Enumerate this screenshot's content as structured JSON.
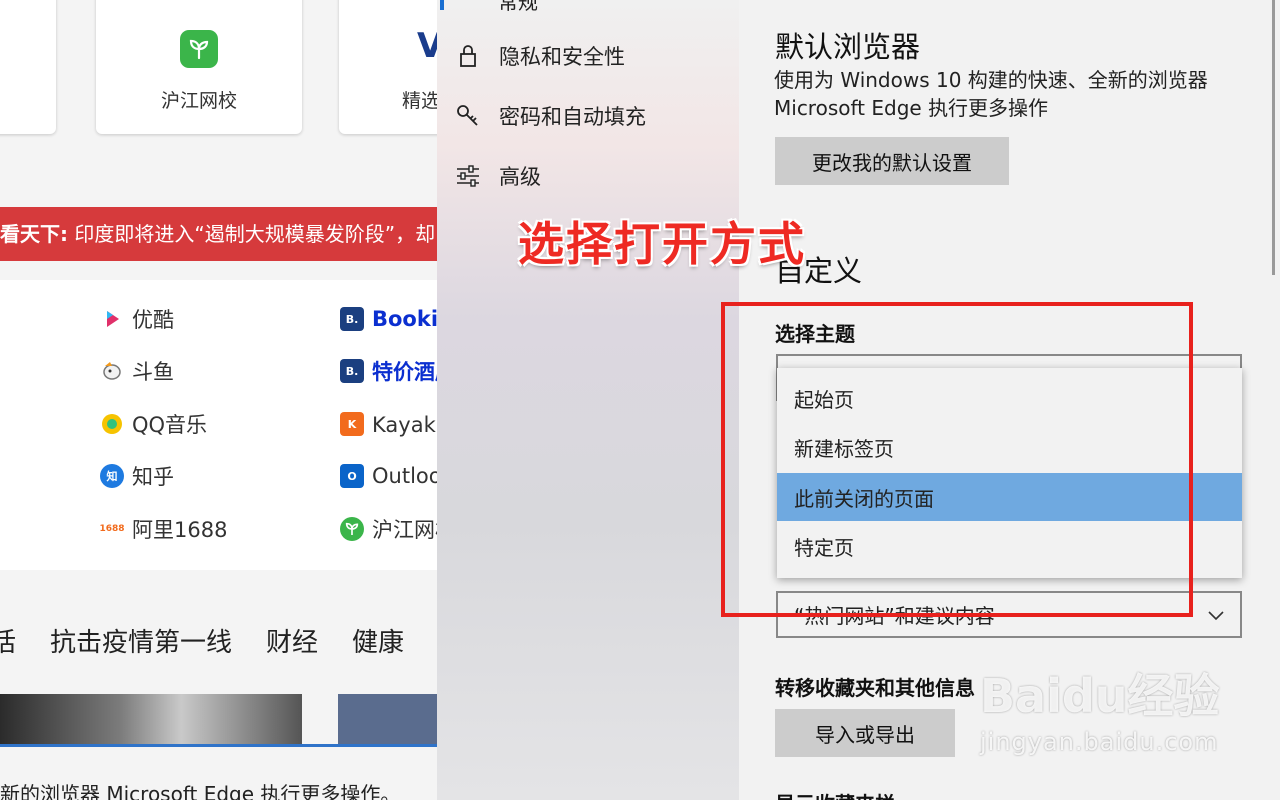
{
  "browser_page": {
    "tiles": [
      {
        "label": "沪江网校"
      },
      {
        "label": "精选"
      }
    ],
    "news_banner": {
      "prefix": "看天下:",
      "text": " 印度即将进入“遏制大规模暴发阶段”，却"
    },
    "links_col1": [
      {
        "label": "优酷",
        "icon": "youku-icon"
      },
      {
        "label": "斗鱼",
        "icon": "douyu-icon"
      },
      {
        "label": "QQ音乐",
        "icon": "qqmusic-icon"
      },
      {
        "label": "知乎",
        "icon": "zhihu-icon",
        "icon_text": "知"
      },
      {
        "label": "阿里1688",
        "icon": "alibaba-icon",
        "icon_text": "1688"
      }
    ],
    "links_col2": [
      {
        "label": "Bookin",
        "icon": "booking-icon",
        "icon_text": "B."
      },
      {
        "label": "特价酒店",
        "icon": "booking-icon",
        "icon_text": "B."
      },
      {
        "label": "Kayak国",
        "icon": "kayak-icon",
        "icon_text": "K"
      },
      {
        "label": "Outloo",
        "icon": "outlook-icon",
        "icon_text": "O"
      },
      {
        "label": "沪江网校",
        "icon": "hujiang-icon"
      }
    ],
    "nav_tabs": [
      "话",
      "抗击疫情第一线",
      "财经",
      "健康"
    ],
    "bottom_text": "新的浏览器 Microsoft Edge 执行更多操作。"
  },
  "settings_nav": {
    "top_label": "常规",
    "items": [
      {
        "label": "隐私和安全性",
        "icon": "lock-icon"
      },
      {
        "label": "密码和自动填充",
        "icon": "key-icon"
      },
      {
        "label": "高级",
        "icon": "sliders-icon"
      }
    ]
  },
  "settings": {
    "default_browser": {
      "title": "默认浏览器",
      "desc_line1": "使用为 Windows 10 构建的快速、全新的浏览器",
      "desc_line2": "Microsoft Edge 执行更多操作",
      "button": "更改我的默认设置"
    },
    "customize": {
      "title": "自定义",
      "theme_label": "选择主题",
      "dropdown_options": [
        "起始页",
        "新建标签页",
        "此前关闭的页面",
        "特定页"
      ],
      "selected_option": "此前关闭的页面",
      "new_tab_select_value": "“热门网站”和建议内容"
    },
    "transfer": {
      "title": "转移收藏夹和其他信息",
      "button": "导入或导出"
    },
    "next_section_title": "显示收藏夹栏"
  },
  "annotation": {
    "text": "选择打开方式",
    "color": "#e8211d"
  },
  "watermark": {
    "brand": "Baidu经验",
    "url": "jingyan.baidu.com"
  }
}
